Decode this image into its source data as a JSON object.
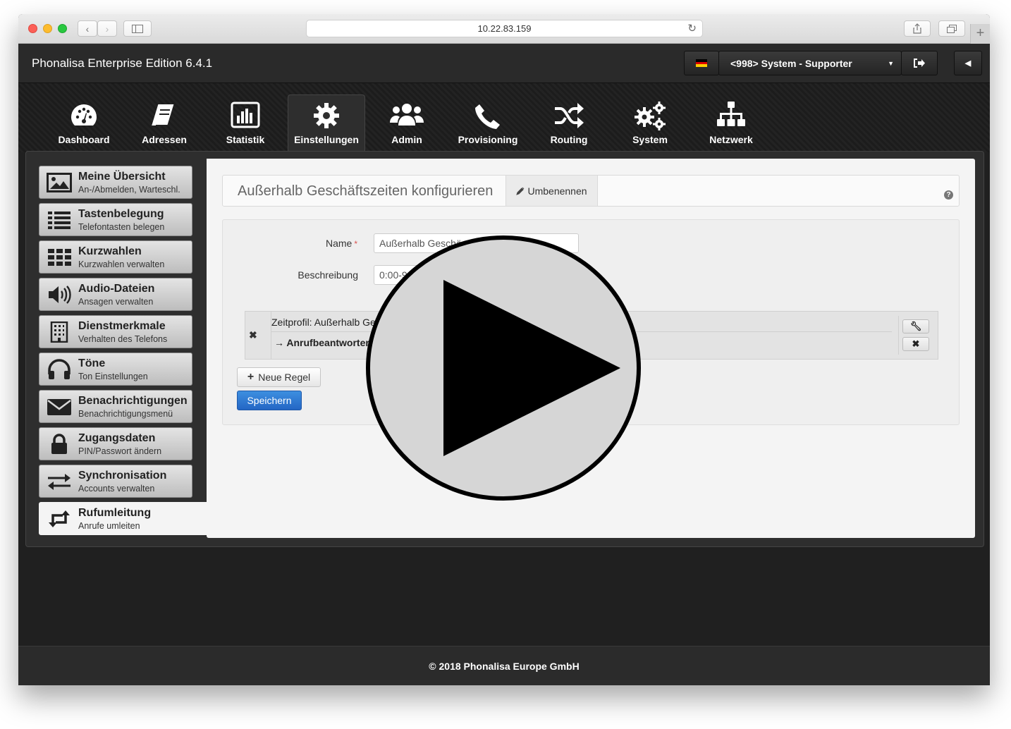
{
  "browser": {
    "url": "10.22.83.159"
  },
  "header": {
    "app_title": "Phonalisa Enterprise Edition 6.4.1",
    "user_select": "<998> System - Supporter"
  },
  "nav": [
    {
      "label": "Dashboard",
      "icon": "dashboard-icon"
    },
    {
      "label": "Adressen",
      "icon": "address-book-icon"
    },
    {
      "label": "Statistik",
      "icon": "bar-chart-icon"
    },
    {
      "label": "Einstellungen",
      "icon": "gear-icon"
    },
    {
      "label": "Admin",
      "icon": "users-icon"
    },
    {
      "label": "Provisioning",
      "icon": "phone-icon"
    },
    {
      "label": "Routing",
      "icon": "shuffle-icon"
    },
    {
      "label": "System",
      "icon": "gears-icon"
    },
    {
      "label": "Netzwerk",
      "icon": "sitemap-icon"
    }
  ],
  "sidebar": {
    "items": [
      {
        "title": "Meine Übersicht",
        "subtitle": "An-/Abmelden, Warteschl.",
        "icon": "picture-icon"
      },
      {
        "title": "Tastenbelegung",
        "subtitle": "Telefontasten belegen",
        "icon": "list-icon"
      },
      {
        "title": "Kurzwahlen",
        "subtitle": "Kurzwahlen verwalten",
        "icon": "grid-icon"
      },
      {
        "title": "Audio-Dateien",
        "subtitle": "Ansagen verwalten",
        "icon": "speaker-icon"
      },
      {
        "title": "Dienstmerkmale",
        "subtitle": "Verhalten des Telefons",
        "icon": "building-icon"
      },
      {
        "title": "Töne",
        "subtitle": "Ton Einstellungen",
        "icon": "headphones-icon"
      },
      {
        "title": "Benachrichtigungen",
        "subtitle": "Benachrichtigungsmenü",
        "icon": "envelope-icon"
      },
      {
        "title": "Zugangsdaten",
        "subtitle": "PIN/Passwort ändern",
        "icon": "lock-icon"
      },
      {
        "title": "Synchronisation",
        "subtitle": "Accounts verwalten",
        "icon": "exchange-icon"
      },
      {
        "title": "Rufumleitung",
        "subtitle": "Anrufe umleiten",
        "icon": "retweet-icon"
      }
    ],
    "active_index": 9
  },
  "page": {
    "title": "Außerhalb Geschäftszeiten konfigurieren",
    "rename_label": "Umbenennen"
  },
  "form": {
    "name_label": "Name",
    "required_mark": "*",
    "name_value": "Außerhalb Geschä",
    "description_label": "Beschreibung",
    "description_value": "0:00-9"
  },
  "rule": {
    "profile_text": "Zeitprofil: Außerhalb Ge",
    "action_text": "Anrufbeantworter"
  },
  "buttons": {
    "new_rule": "Neue Regel",
    "save": "Speichern"
  },
  "footer": {
    "copyright": "© 2018 Phonalisa Europe GmbH"
  },
  "colors": {
    "save_button": "#2466c4",
    "required": "#d9534f"
  }
}
